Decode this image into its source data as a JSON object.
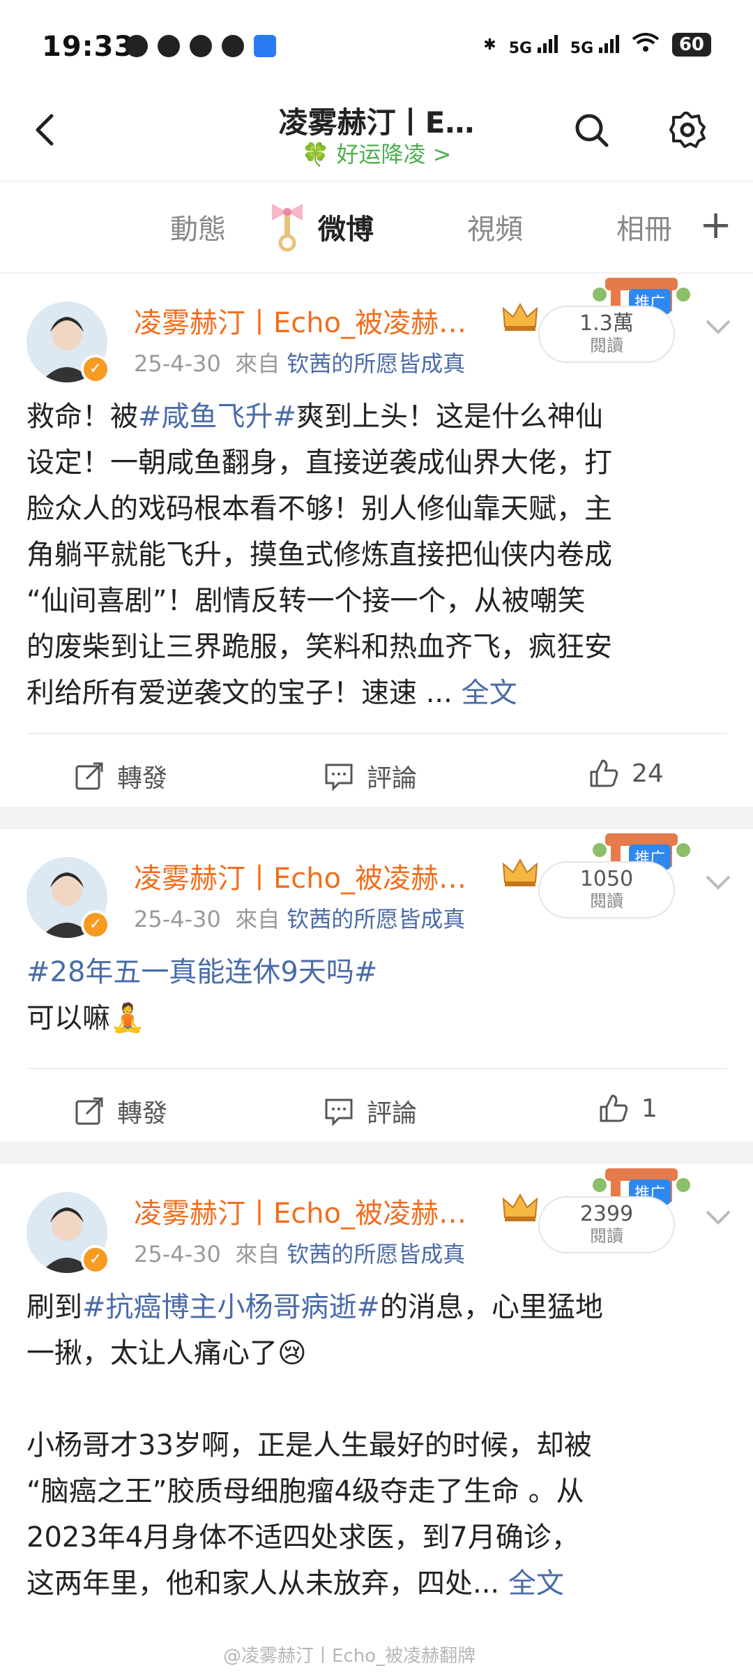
{
  "status_bar": {
    "time": "19:33",
    "network_1": "5G",
    "network_2": "5G",
    "battery": "60"
  },
  "header": {
    "title": "凌雾赫汀丨E…",
    "subtitle": "🍀 好运降凌 >"
  },
  "tabs": [
    {
      "label": "動態"
    },
    {
      "label": "微博",
      "active": true
    },
    {
      "label": "視頻"
    },
    {
      "label": "相冊"
    }
  ],
  "posts": [
    {
      "author": "凌雾赫汀丨Echo_被凌赫…",
      "date": "25-4-30",
      "from_label": "來自",
      "source": "钦茜的所愿皆成真",
      "reads_value": "1.3萬",
      "reads_label": "閱讀",
      "promo_tag": "推广",
      "text_lines": [
        {
          "pre": "救命！被",
          "tag": "#咸鱼飞升#",
          "post": "爽到上头！这是什么神仙"
        },
        {
          "pre": "设定！一朝咸鱼翻身，直接逆袭成仙界大佬，打"
        },
        {
          "pre": "脸众人的戏码根本看不够！别人修仙靠天赋，主"
        },
        {
          "pre": "角躺平就能飞升，摸鱼式修炼直接把仙侠内卷成"
        },
        {
          "pre": "“仙间喜剧”！剧情反转一个接一个，从被嘲笑"
        },
        {
          "pre": "的废柴到让三界跪服，笑料和热血齐飞，疯狂安"
        },
        {
          "pre": "利给所有爱逆袭文的宝子！速速 ...",
          "more": "全文"
        }
      ],
      "repost": "轉發",
      "comment": "評論",
      "likes": "24"
    },
    {
      "author": "凌雾赫汀丨Echo_被凌赫…",
      "date": "25-4-30",
      "from_label": "來自",
      "source": "钦茜的所愿皆成真",
      "reads_value": "1050",
      "reads_label": "閱讀",
      "promo_tag": "推广",
      "text_lines": [
        {
          "tag": "#28年五一真能连休9天吗#"
        },
        {
          "pre": "可以嘛🧘"
        }
      ],
      "repost": "轉發",
      "comment": "評論",
      "likes": "1"
    },
    {
      "author": "凌雾赫汀丨Echo_被凌赫…",
      "date": "25-4-30",
      "from_label": "來自",
      "source": "钦茜的所愿皆成真",
      "reads_value": "2399",
      "reads_label": "閱讀",
      "promo_tag": "推广",
      "text_lines": [
        {
          "pre": "刷到",
          "tag": "#抗癌博主小杨哥病逝#",
          "post": "的消息，心里猛地"
        },
        {
          "pre": "一揪，太让人痛心了😢"
        },
        {
          "pre": ""
        },
        {
          "pre": "小杨哥才33岁啊，正是人生最好的时候，却被"
        },
        {
          "pre": "“脑癌之王”胶质母细胞瘤4级夺走了生命 。从"
        },
        {
          "pre": "2023年4月身体不适四处求医，到7月确诊，"
        },
        {
          "pre": "这两年里，他和家人从未放弃，四处...",
          "more": "全文"
        }
      ]
    }
  ],
  "watermark": "@凌雾赫汀丨Echo_被凌赫翻牌",
  "colors": {
    "username": "#f26d1d",
    "link": "#4a6ba8",
    "promo": "#2e88f0",
    "subtitle": "#4caf50"
  },
  "icons": [
    "back-icon",
    "search-icon",
    "gear-icon",
    "plus-icon",
    "verified-icon",
    "crown-icon",
    "chevron-down-icon",
    "repost-icon",
    "comment-icon",
    "like-icon"
  ]
}
